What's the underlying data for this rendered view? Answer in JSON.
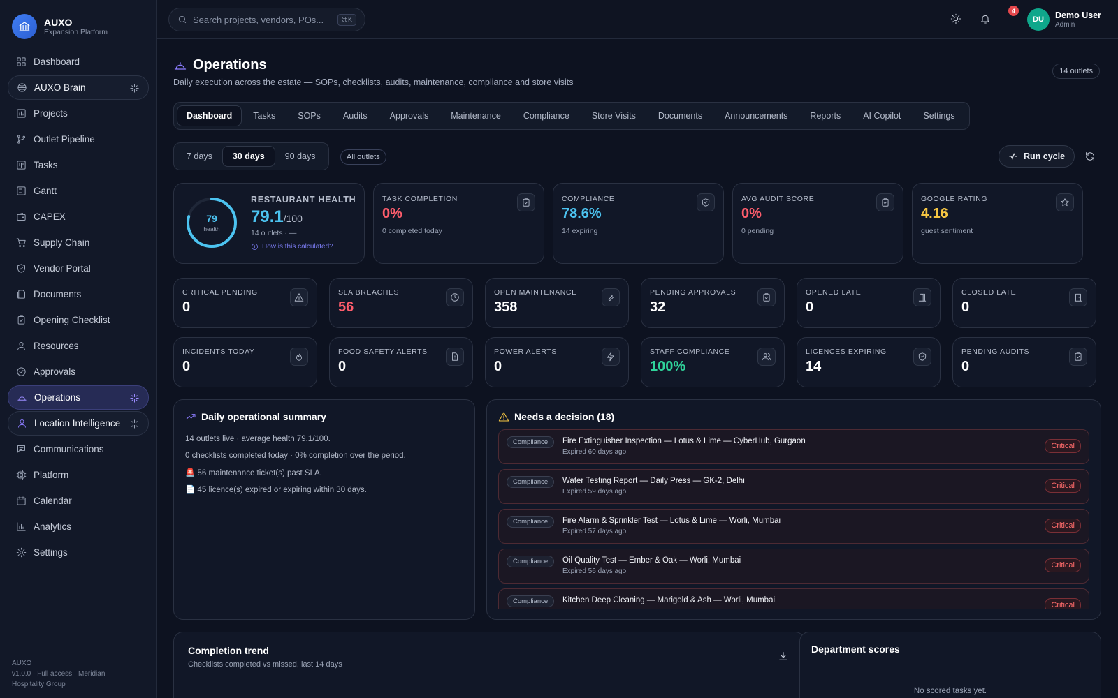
{
  "brand": {
    "name": "AUXO",
    "sub": "Expansion Platform"
  },
  "sidebar": {
    "items": [
      {
        "label": "Dashboard"
      },
      {
        "label": "AUXO Brain"
      },
      {
        "label": "Projects"
      },
      {
        "label": "Outlet Pipeline"
      },
      {
        "label": "Tasks"
      },
      {
        "label": "Gantt"
      },
      {
        "label": "CAPEX"
      },
      {
        "label": "Supply Chain"
      },
      {
        "label": "Vendor Portal"
      },
      {
        "label": "Documents"
      },
      {
        "label": "Opening Checklist"
      },
      {
        "label": "Resources"
      },
      {
        "label": "Approvals"
      },
      {
        "label": "Operations"
      },
      {
        "label": "Location Intelligence"
      },
      {
        "label": "Communications"
      },
      {
        "label": "Platform"
      },
      {
        "label": "Calendar"
      },
      {
        "label": "Analytics"
      },
      {
        "label": "Settings"
      }
    ],
    "footer": {
      "line1": "AUXO",
      "line2": "v1.0.0 · Full access · Meridian",
      "line3": "Hospitality Group"
    }
  },
  "topbar": {
    "search_placeholder": "Search projects, vendors, POs...",
    "shortcut": "⌘K",
    "notifications": "4",
    "user": {
      "initials": "DU",
      "name": "Demo User",
      "role": "Admin"
    }
  },
  "page": {
    "title": "Operations",
    "subtitle": "Daily execution across the estate — SOPs, checklists, audits, maintenance, compliance and store visits",
    "outlets_chip": "14 outlets"
  },
  "tabs": [
    "Dashboard",
    "Tasks",
    "SOPs",
    "Audits",
    "Approvals",
    "Maintenance",
    "Compliance",
    "Store Visits",
    "Documents",
    "Announcements",
    "Reports",
    "AI Copilot",
    "Settings"
  ],
  "range": {
    "options": [
      "7 days",
      "30 days",
      "90 days"
    ],
    "selected": "30 days",
    "outlets_filter": "All outlets"
  },
  "actions": {
    "run_cycle": "Run cycle"
  },
  "health": {
    "ring_value": "79",
    "ring_label": "health",
    "score_fraction": 0.791,
    "title": "RESTAURANT HEALTH",
    "value": "79.1",
    "suffix": "/100",
    "note": "14 outlets · —",
    "link": "How is this calculated?"
  },
  "kpis": [
    {
      "label": "TASK COMPLETION",
      "value": "0%",
      "note": "0 completed today",
      "icon": "clipboard-icon"
    },
    {
      "label": "COMPLIANCE",
      "value": "78.6%",
      "note": "14 expiring",
      "icon": "shield-icon"
    },
    {
      "label": "AVG AUDIT SCORE",
      "value": "0%",
      "note": "0 pending",
      "icon": "clipboard-icon"
    },
    {
      "label": "GOOGLE RATING",
      "value": "4.16",
      "note": "guest sentiment",
      "icon": "star-icon"
    }
  ],
  "metrics_row1": [
    {
      "label": "CRITICAL PENDING",
      "value": "0",
      "icon": "warning-icon"
    },
    {
      "label": "SLA BREACHES",
      "value": "56",
      "icon": "clock-icon"
    },
    {
      "label": "OPEN MAINTENANCE",
      "value": "358",
      "icon": "wrench-icon"
    },
    {
      "label": "PENDING APPROVALS",
      "value": "32",
      "icon": "clipboard-icon"
    },
    {
      "label": "OPENED LATE",
      "value": "0",
      "icon": "door-open-icon"
    },
    {
      "label": "CLOSED LATE",
      "value": "0",
      "icon": "door-closed-icon"
    }
  ],
  "metrics_row2": [
    {
      "label": "INCIDENTS TODAY",
      "value": "0",
      "icon": "flame-icon"
    },
    {
      "label": "FOOD SAFETY ALERTS",
      "value": "0",
      "icon": "file-alert-icon"
    },
    {
      "label": "POWER ALERTS",
      "value": "0",
      "icon": "bolt-icon"
    },
    {
      "label": "STAFF COMPLIANCE",
      "value": "100%",
      "icon": "users-icon"
    },
    {
      "label": "LICENCES EXPIRING",
      "value": "14",
      "icon": "shield-icon"
    },
    {
      "label": "PENDING AUDITS",
      "value": "0",
      "icon": "clipboard-icon"
    }
  ],
  "colors": {
    "accent": "#8b7cff",
    "info": "#4cc3f0",
    "danger": "#ff5d6c",
    "success": "#2fd39a",
    "warning": "#f5c542"
  },
  "summary": {
    "title": "Daily operational summary",
    "lines": [
      "14 outlets live · average health 79.1/100.",
      "0 checklists completed today · 0% completion over the period.",
      "🚨 56 maintenance ticket(s) past SLA.",
      "📄 45 licence(s) expired or expiring within 30 days."
    ]
  },
  "decisions": {
    "title": "Needs a decision (18)",
    "items": [
      {
        "tag": "Compliance",
        "title": "Fire Extinguisher Inspection — Lotus & Lime — CyberHub, Gurgaon",
        "sub": "Expired 60 days ago",
        "severity": "Critical"
      },
      {
        "tag": "Compliance",
        "title": "Water Testing Report — Daily Press — GK-2, Delhi",
        "sub": "Expired 59 days ago",
        "severity": "Critical"
      },
      {
        "tag": "Compliance",
        "title": "Fire Alarm & Sprinkler Test — Lotus & Lime — Worli, Mumbai",
        "sub": "Expired 57 days ago",
        "severity": "Critical"
      },
      {
        "tag": "Compliance",
        "title": "Oil Quality Test — Ember & Oak — Worli, Mumbai",
        "sub": "Expired 56 days ago",
        "severity": "Critical"
      },
      {
        "tag": "Compliance",
        "title": "Kitchen Deep Cleaning — Marigold & Ash — Worli, Mumbai",
        "sub": "",
        "severity": "Critical"
      }
    ]
  },
  "trend": {
    "title": "Completion trend",
    "subtitle": "Checklists completed vs missed, last 14 days"
  },
  "departments": {
    "title": "Department scores",
    "empty": "No scored tasks yet."
  }
}
